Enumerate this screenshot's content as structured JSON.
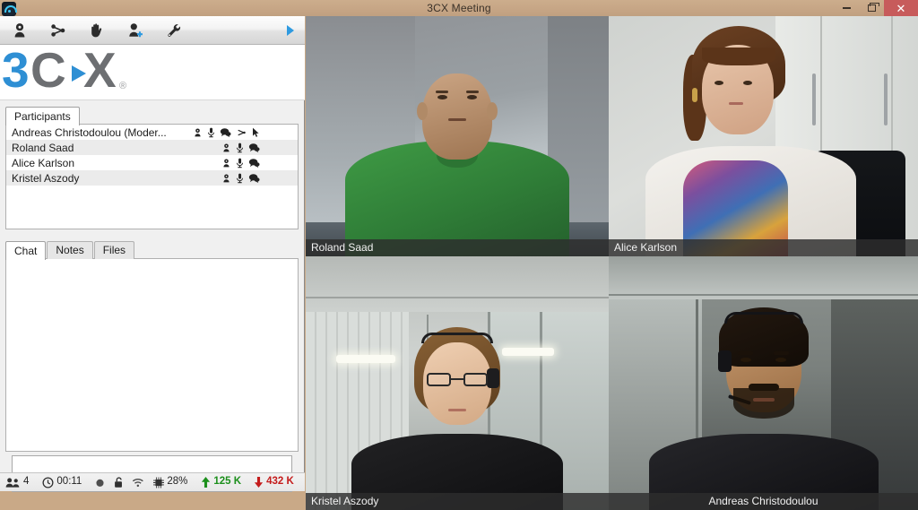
{
  "window": {
    "title": "3CX Meeting",
    "app_icon": "3cx-app-icon",
    "controls": {
      "minimize": "minimize",
      "maximize": "restore",
      "close": "close"
    }
  },
  "toolbar": {
    "buttons": [
      {
        "name": "presenter-webcam-button",
        "icon": "webcam-icon",
        "title": "Webcam"
      },
      {
        "name": "share-button",
        "icon": "share-icon",
        "title": "Share"
      },
      {
        "name": "raise-hand-button",
        "icon": "hand-icon",
        "title": "Raise hand"
      },
      {
        "name": "invite-participant-button",
        "icon": "add-user-icon",
        "title": "Invite"
      },
      {
        "name": "settings-button",
        "icon": "wrench-icon",
        "title": "Settings"
      }
    ],
    "overflow": "overflow-arrow-icon"
  },
  "logo": {
    "part_3": "3",
    "part_c": "C",
    "part_x": "X",
    "registered": "®",
    "blue": "#2e8fd4",
    "gray": "#6d6f72"
  },
  "participants_panel": {
    "tabs": [
      {
        "label": "Participants",
        "active": true
      }
    ],
    "rows": [
      {
        "name": "Andreas Christodoulou (Moder...",
        "icons": [
          "webcam-icon",
          "mic-icon",
          "chat-icon",
          "share-icon",
          "pointer-icon"
        ],
        "alt": false
      },
      {
        "name": "Roland Saad",
        "icons": [
          "webcam-icon",
          "mic-icon",
          "chat-icon"
        ],
        "alt": true
      },
      {
        "name": "Alice Karlson",
        "icons": [
          "webcam-icon",
          "mic-icon",
          "chat-icon"
        ],
        "alt": false
      },
      {
        "name": "Kristel Aszody",
        "icons": [
          "webcam-icon",
          "mic-icon",
          "chat-icon"
        ],
        "alt": true
      }
    ]
  },
  "chat_panel": {
    "tabs": [
      {
        "label": "Chat",
        "active": true
      },
      {
        "label": "Notes",
        "active": false
      },
      {
        "label": "Files",
        "active": false
      }
    ],
    "messages": [],
    "input": {
      "value": "",
      "placeholder": ""
    }
  },
  "statusbar": {
    "participants_icon": "people-icon",
    "participants_count": "4",
    "clock_icon": "clock-icon",
    "elapsed": "00:11",
    "record_icon": "record-dot-icon",
    "lock_icon": "unlocked-padlock-icon",
    "network_icon": "wifi-icon",
    "cpu_icon": "cpu-icon",
    "cpu": "28%",
    "upload_icon": "upload-arrow-icon",
    "upload": "125 K",
    "upload_color": "#1b8f1b",
    "download_icon": "download-arrow-icon",
    "download": "432 K",
    "download_color": "#c41b1b"
  },
  "video_grid": {
    "tiles": [
      {
        "name": "Roland Saad",
        "align": "left"
      },
      {
        "name": "Alice Karlson",
        "align": "left"
      },
      {
        "name": "Kristel Aszody",
        "align": "left"
      },
      {
        "name": "Andreas Christodoulou",
        "align": "center"
      }
    ]
  }
}
